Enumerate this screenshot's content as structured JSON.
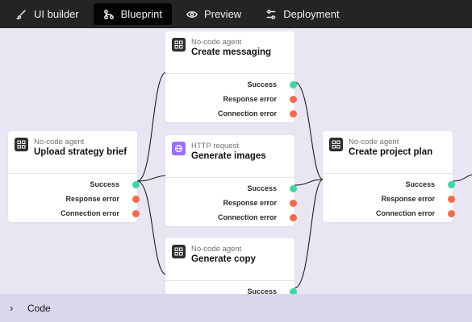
{
  "toolbar": {
    "tabs": [
      {
        "label": "UI builder",
        "icon": "brush-icon",
        "active": false
      },
      {
        "label": "Blueprint",
        "icon": "flow-icon",
        "active": true
      },
      {
        "label": "Preview",
        "icon": "eye-icon",
        "active": false
      },
      {
        "label": "Deployment",
        "icon": "sliders-icon",
        "active": false
      }
    ]
  },
  "nodes": {
    "upload": {
      "type": "No-code agent",
      "title": "Upload strategy brief",
      "ports": [
        "Success",
        "Response error",
        "Connection error"
      ]
    },
    "messaging": {
      "type": "No-code agent",
      "title": "Create messaging",
      "ports": [
        "Success",
        "Response error",
        "Connection error"
      ]
    },
    "images": {
      "type": "HTTP request",
      "title": "Generate images",
      "ports": [
        "Success",
        "Response error",
        "Connection error"
      ]
    },
    "copy": {
      "type": "No-code agent",
      "title": "Generate copy",
      "ports": [
        "Success"
      ]
    },
    "plan": {
      "type": "No-code agent",
      "title": "Create project plan",
      "ports": [
        "Success",
        "Response error",
        "Connection error"
      ]
    }
  },
  "bottom_panel": {
    "label": "Code"
  },
  "colors": {
    "success": "#3fd6a6",
    "error": "#f26b4b",
    "canvas": "#e9e5f3",
    "toolbar": "#242424"
  }
}
